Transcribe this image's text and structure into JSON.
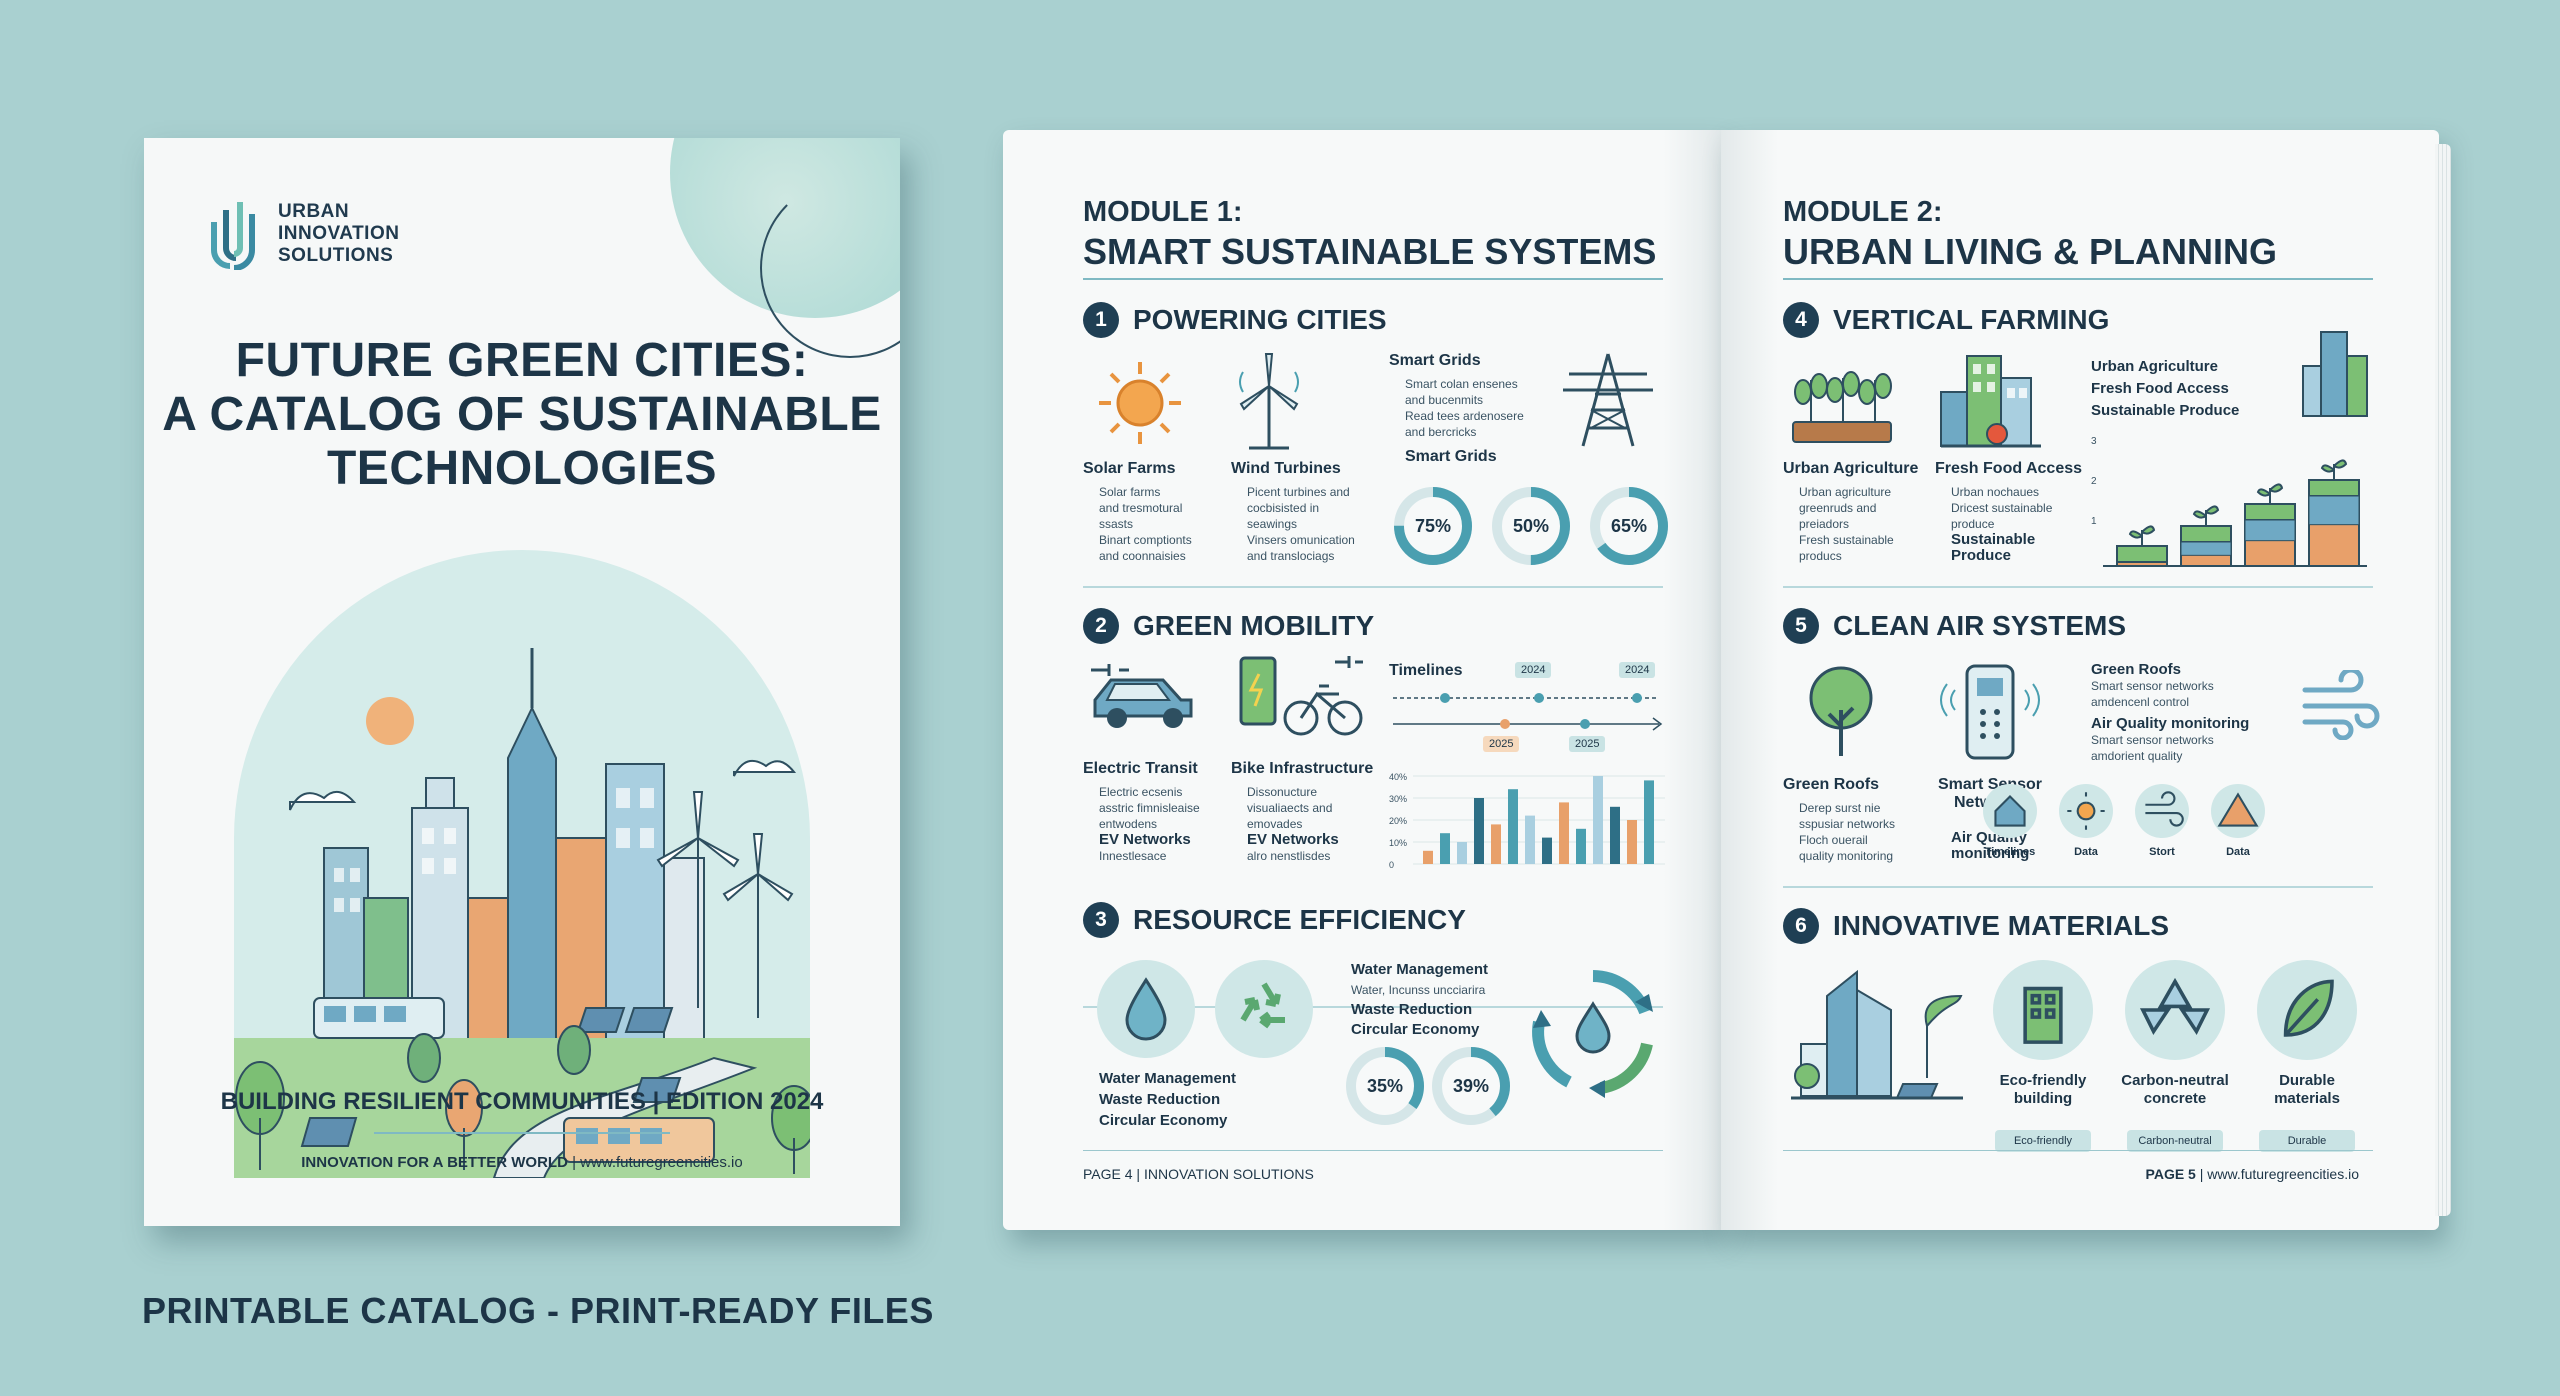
{
  "cover": {
    "brand": [
      "URBAN",
      "INNOVATION",
      "SOLUTIONS"
    ],
    "title": [
      "FUTURE GREEN CITIES:",
      "A CATALOG OF SUSTAINABLE",
      "TECHNOLOGIES"
    ],
    "subtitle": "BUILDING RESILIENT COMMUNITIES | EDITION 2024",
    "footer_bold": "INNOVATION FOR A BETTER WORLD",
    "footer_url": " | www.futuregreencities.io"
  },
  "caption": "PRINTABLE CATALOG - PRINT-READY FILES",
  "left_page": {
    "module_label": "MODULE 1:",
    "module_title": "SMART SUSTAINABLE SYSTEMS",
    "s1": {
      "num": "1",
      "title": "POWERING CITIES",
      "solar": "Solar Farms",
      "solar_b": [
        "Solar farms",
        "and tresmotural",
        "ssasts",
        "Binart comptionts",
        "and coonnaisies"
      ],
      "wind": "Wind Turbines",
      "wind_b": [
        "Picent turbines and",
        "cocbisisted in",
        "seawings",
        "Vinsers omunication",
        "and translociags"
      ],
      "grids": "Smart Grids",
      "grids_b": [
        "Smart colan ensenes",
        "and bucenmits",
        "Read tees ardenosere",
        "and bercricks"
      ],
      "grids2": "Smart Grids",
      "donuts": [
        "75%",
        "50%",
        "65%"
      ],
      "donut_values": [
        75,
        50,
        65
      ]
    },
    "s2": {
      "num": "2",
      "title": "GREEN MOBILITY",
      "transit": "Electric Transit",
      "transit_b": [
        "Electric ecsenis",
        "asstric fimnisleaise",
        "entwodens"
      ],
      "ev": "EV Networks",
      "ev_sub": "Innestlesace",
      "bike": "Bike Infrastructure",
      "bike_b": [
        "Dissonucture",
        "visualiaects and",
        "emovades"
      ],
      "ev2": "EV Networks",
      "ev2_sub": "alro nenstlisdes",
      "timelines": "Timelines",
      "tl_top": [
        "2024",
        "2024"
      ],
      "tl_bottom": [
        "2025",
        "2025"
      ],
      "y_ticks": [
        "40%",
        "30%",
        "20%",
        "10%",
        "0"
      ],
      "bars": [
        6,
        14,
        10,
        30,
        18,
        34,
        22,
        12,
        28,
        16,
        40,
        26,
        20,
        38
      ]
    },
    "s3": {
      "num": "3",
      "title": "RESOURCE EFFICIENCY",
      "list_a": [
        "Water Management",
        "Waste Reduction",
        "Circular Economy"
      ],
      "list_b_head": "Water Management",
      "list_b_sub": "Water, Incunss uncciarira",
      "list_b": [
        "Waste Reduction",
        "Circular Economy"
      ],
      "donuts": [
        "35%",
        "39%"
      ],
      "donut_values": [
        35,
        39
      ]
    },
    "footer": "PAGE 4 | INNOVATION SOLUTIONS"
  },
  "right_page": {
    "module_label": "MODULE 2:",
    "module_title": "URBAN LIVING & PLANNING",
    "s4": {
      "num": "4",
      "title": "VERTICAL FARMING",
      "ua": "Urban Agriculture",
      "ua_b": [
        "Urban agriculture",
        "greenruds and",
        "preiadors",
        "Fresh sustainable",
        "producs"
      ],
      "ffa": "Fresh Food Access",
      "ffa_b": [
        "Urban nochaues",
        "Dricest sustainable",
        "produce"
      ],
      "sp": "Sustainable Produce",
      "list_head": "Urban Agriculture",
      "list": [
        "Fresh Food Access",
        "Sustainable Produce"
      ],
      "y_ticks": [
        "3",
        "2",
        "1"
      ]
    },
    "s5": {
      "num": "5",
      "title": "CLEAN AIR SYSTEMS",
      "roofs": "Green Roofs",
      "roofs_b": [
        "Derep surst nie",
        "sspusiar networks",
        "Floch ouerail",
        "quality monitoring"
      ],
      "sensor": "Smart Sensor Networks",
      "aq": "Air Quality monitoring",
      "gr_head": "Green Roofs",
      "gr_b": [
        "Smart sensor networks",
        "amdencenl control"
      ],
      "aq_head": "Air Quality monitoring",
      "aq_b": [
        "Smart sensor networks",
        "amdorient quality"
      ],
      "icons": [
        "Timelines",
        "Data",
        "Stort",
        "Data"
      ]
    },
    "s6": {
      "num": "6",
      "title": "INNOVATIVE MATERIALS",
      "items": [
        {
          "label": [
            "Eco-friendly",
            "building"
          ],
          "pill": "Eco-friendly"
        },
        {
          "label": [
            "Carbon-neutral",
            "concrete"
          ],
          "pill": "Carbon-neutral"
        },
        {
          "label": [
            "Durable",
            "materials"
          ],
          "pill": "Durable"
        }
      ]
    },
    "footer_bold": "PAGE 5",
    "footer_url": " | www.futuregreencities.io"
  },
  "colors": {
    "navy": "#1d3547",
    "teal": "#4a9fb0",
    "green": "#7cbf74",
    "orange": "#e8a06a",
    "bg": "#a9d0d0"
  }
}
